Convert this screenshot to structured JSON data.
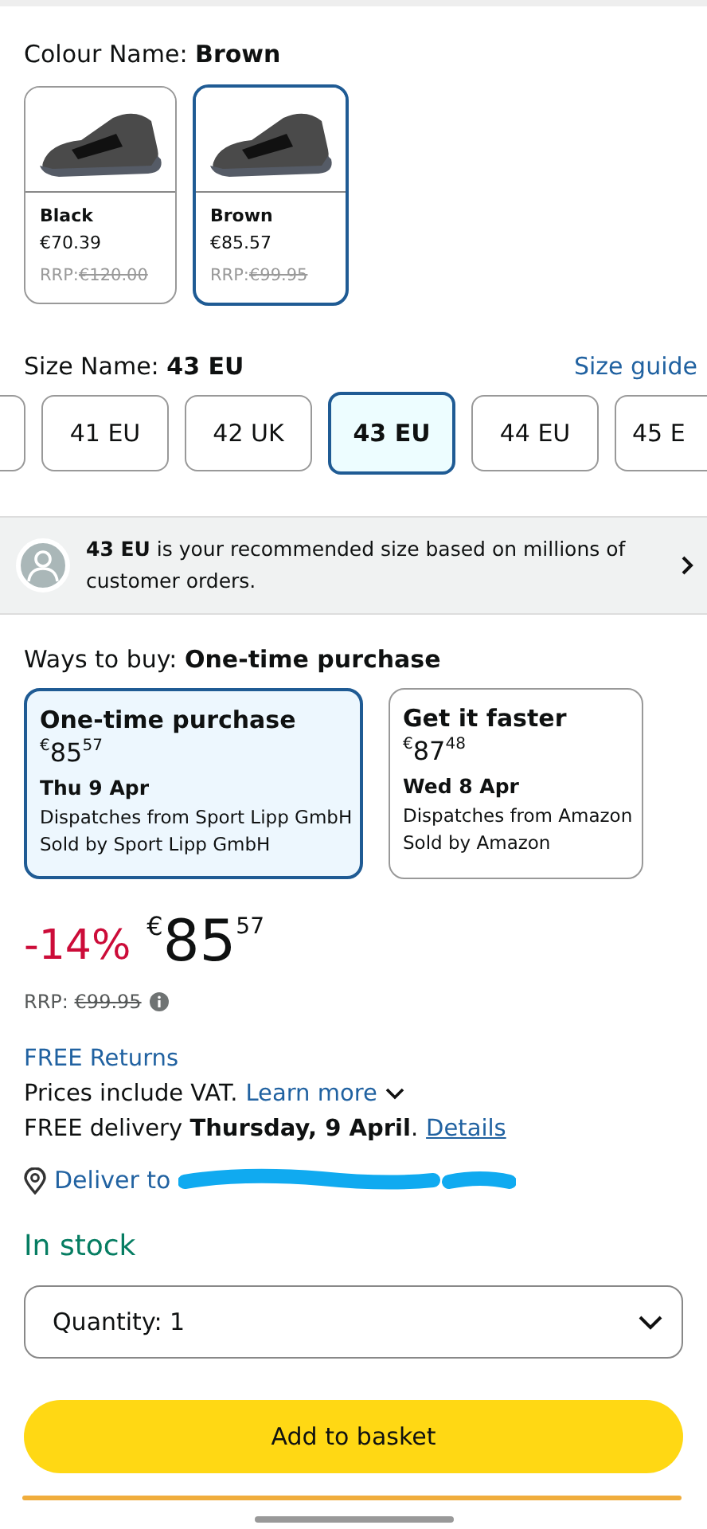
{
  "colour": {
    "label": "Colour Name: **Brown**",
    "options": [
      {
        "name": "Black",
        "price": "€70.39",
        "rrp": "RRP:",
        "rrp_value": "€120.00",
        "selected": false
      },
      {
        "name": "Brown",
        "price": "€85.57",
        "rrp": "RRP:",
        "rrp_value": "€99.95",
        "selected": true
      }
    ]
  },
  "size": {
    "label": "Size Name: **43 EU**",
    "guide": "Size guide",
    "options": [
      {
        "label": "41 EU",
        "selected": false
      },
      {
        "label": "42 UK",
        "selected": false
      },
      {
        "label": "43 EU",
        "selected": true
      },
      {
        "label": "44 EU",
        "selected": false
      },
      {
        "label": "45 E",
        "selected": false
      }
    ]
  },
  "recommendation": {
    "text": "**43 EU** is your recommended size based on millions of customer orders."
  },
  "ways_to_buy": {
    "label": "Ways to buy: **One-time purchase**",
    "options": [
      {
        "title": "One-time purchase",
        "currency": "€",
        "whole": "85",
        "fraction": "57",
        "date": "Thu 9 Apr",
        "dispatch": "Dispatches from Sport Lipp GmbH",
        "seller": "Sold by Sport Lipp GmbH",
        "selected": true
      },
      {
        "title": "Get it faster",
        "currency": "€",
        "whole": "87",
        "fraction": "48",
        "date": "Wed 8 Apr",
        "dispatch": "Dispatches from Amazon",
        "seller": "Sold by Amazon",
        "selected": false
      }
    ]
  },
  "price": {
    "discount": "-14%",
    "currency": "€",
    "whole": "85",
    "fraction": "57",
    "rrp_label": "RRP:",
    "rrp_value": "€99.95"
  },
  "returns": "FREE Returns",
  "vat": {
    "text": "Prices include VAT.",
    "link": "Learn more"
  },
  "delivery": {
    "text": "FREE delivery **Thursday, 9 April**.",
    "link": "Details"
  },
  "deliver_to": "Deliver to",
  "stock": "In stock",
  "quantity": "Quantity:  1",
  "add_button": "Add to basket"
}
